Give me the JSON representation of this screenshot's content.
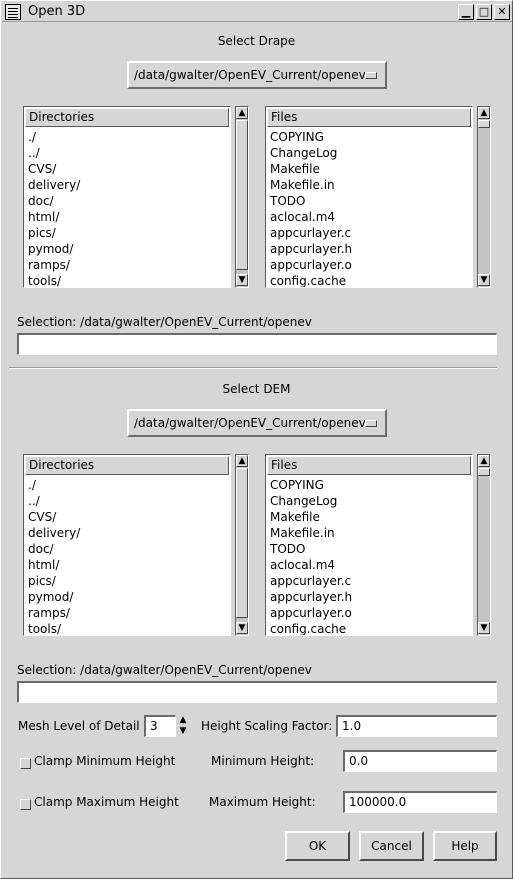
{
  "window": {
    "title": "Open 3D",
    "menu_icon": "window-menu-icon",
    "controls": {
      "minimize": "minimize-icon",
      "maximize": "maximize-icon",
      "close": "close-icon"
    }
  },
  "drape": {
    "heading": "Select Drape",
    "path_option": "/data/gwalter/OpenEV_Current/openev",
    "directories_header": "Directories",
    "directories": [
      "./",
      "../",
      "CVS/",
      "delivery/",
      "doc/",
      "html/",
      "pics/",
      "pymod/",
      "ramps/",
      "tools/"
    ],
    "files_header": "Files",
    "files": [
      "COPYING",
      "ChangeLog",
      "Makefile",
      "Makefile.in",
      "TODO",
      "aclocal.m4",
      "appcurlayer.c",
      "appcurlayer.h",
      "appcurlayer.o",
      "config.cache"
    ],
    "selection_label": "Selection: /data/gwalter/OpenEV_Current/openev",
    "selection_value": ""
  },
  "dem": {
    "heading": "Select DEM",
    "path_option": "/data/gwalter/OpenEV_Current/openev",
    "directories_header": "Directories",
    "directories": [
      "./",
      "../",
      "CVS/",
      "delivery/",
      "doc/",
      "html/",
      "pics/",
      "pymod/",
      "ramps/",
      "tools/"
    ],
    "files_header": "Files",
    "files": [
      "COPYING",
      "ChangeLog",
      "Makefile",
      "Makefile.in",
      "TODO",
      "aclocal.m4",
      "appcurlayer.c",
      "appcurlayer.h",
      "appcurlayer.o",
      "config.cache"
    ],
    "selection_label": "Selection: /data/gwalter/OpenEV_Current/openev",
    "selection_value": ""
  },
  "options": {
    "mesh_label": "Mesh Level of Detail",
    "mesh_value": "3",
    "height_scaling_label": "Height Scaling Factor:",
    "height_scaling_value": "1.0",
    "clamp_min_label": "Clamp Minimum Height",
    "clamp_min_checked": false,
    "min_height_label": "Minimum Height:",
    "min_height_value": "0.0",
    "clamp_max_label": "Clamp Maximum Height",
    "clamp_max_checked": false,
    "max_height_label": "Maximum Height:",
    "max_height_value": "100000.0"
  },
  "buttons": {
    "ok": "OK",
    "cancel": "Cancel",
    "help": "Help"
  }
}
